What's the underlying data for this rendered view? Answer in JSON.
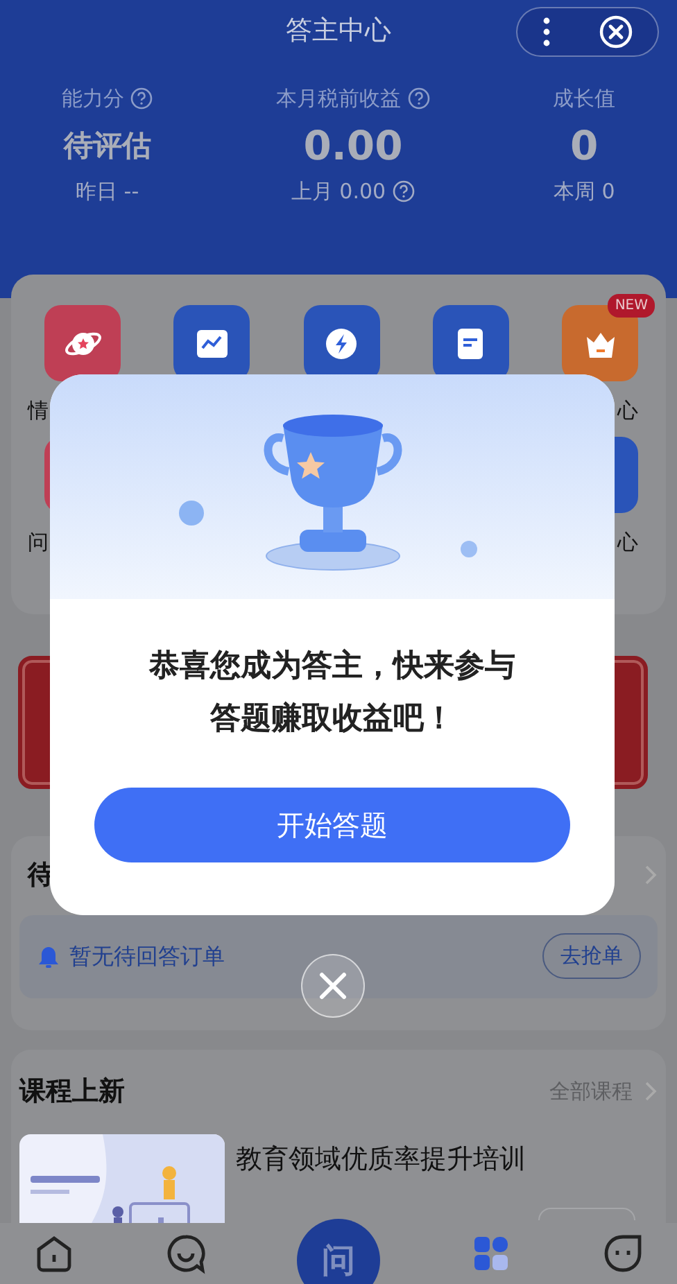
{
  "header": {
    "title": "答主中心"
  },
  "stats": [
    {
      "label": "能力分",
      "help": true,
      "value": "待评估",
      "sub": "昨日 --",
      "sub_help": false
    },
    {
      "label": "本月税前收益",
      "help": true,
      "value": "0.00",
      "sub": "上月 0.00",
      "sub_help": true
    },
    {
      "label": "成长值",
      "help": false,
      "value": "0",
      "sub": "本周 0",
      "sub_help": false
    }
  ],
  "tool_rows": [
    [
      {
        "kind": "planet",
        "color": "#bf3f55",
        "label": "情"
      },
      {
        "kind": "chart",
        "color": "#2a54b8"
      },
      {
        "kind": "bolt",
        "color": "#2a54b8"
      },
      {
        "kind": "doc",
        "color": "#2a54b8"
      },
      {
        "kind": "crown",
        "color": "#c86a2e",
        "badge": "NEW",
        "label": "心"
      }
    ],
    [
      {
        "kind": "blank",
        "color": "#bf3f55",
        "label": "问"
      },
      {
        "kind": "blank",
        "color": "#2a54b8",
        "label": "心"
      }
    ]
  ],
  "orders": {
    "title": "待",
    "empty_text": "暂无待回答订单",
    "action": "去抢单"
  },
  "courses": {
    "title": "课程上新",
    "more": "全部课程",
    "items": [
      {
        "title": "教育领域优质率提升培训"
      }
    ]
  },
  "nav": [
    {
      "kind": "home"
    },
    {
      "kind": "chat"
    },
    {
      "kind": "ask",
      "label": "问"
    },
    {
      "kind": "apps"
    },
    {
      "kind": "face"
    }
  ],
  "dialog": {
    "message": "恭喜您成为答主，快来参与答题赚取收益吧！",
    "button": "开始答题"
  }
}
